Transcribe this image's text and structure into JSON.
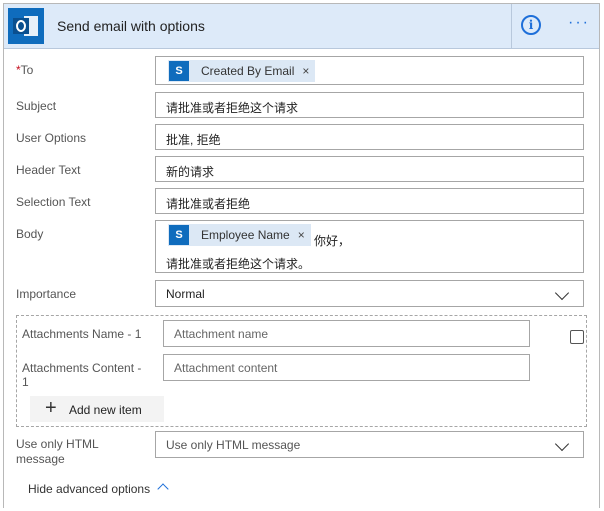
{
  "header": {
    "title": "Send email with options",
    "info_label": "i",
    "more_label": "···"
  },
  "fields": {
    "to": {
      "label": "To",
      "required_mark": "*",
      "token": "Created By Email",
      "token_close": "×"
    },
    "subject": {
      "label": "Subject",
      "value": "请批准或者拒绝这个请求"
    },
    "user_options": {
      "label": "User Options",
      "value": "批准, 拒绝"
    },
    "header_text": {
      "label": "Header Text",
      "value": "新的请求"
    },
    "selection_text": {
      "label": "Selection Text",
      "value": "请批准或者拒绝"
    },
    "body": {
      "label": "Body",
      "token": "Employee Name",
      "token_close": "×",
      "after_token": "你好，",
      "line2": "请批准或者拒绝这个请求。"
    },
    "importance": {
      "label": "Importance",
      "value": "Normal"
    }
  },
  "attachments": {
    "name_label": "Attachments Name - 1",
    "name_placeholder": "Attachment name",
    "content_label_line1": "Attachments Content -",
    "content_label_line2": "1",
    "content_placeholder": "Attachment content",
    "add_item_label": "Add new item"
  },
  "html_message": {
    "label_line1": "Use only HTML",
    "label_line2": "message",
    "placeholder": "Use only HTML message"
  },
  "advanced": {
    "toggle_label": "Hide advanced options"
  },
  "colors": {
    "accent": "#1e6fd9",
    "header_bg": "#ddeaf9",
    "brand": "#0f6cbd",
    "required": "#c50f1f"
  },
  "icons": {
    "app": "outlook-icon",
    "token": "sharepoint-icon",
    "info": "info-icon",
    "more": "ellipsis-icon",
    "delete": "delete-icon",
    "add": "plus-icon",
    "dropdown": "chevron-down-icon",
    "collapse": "chevron-up-icon"
  }
}
